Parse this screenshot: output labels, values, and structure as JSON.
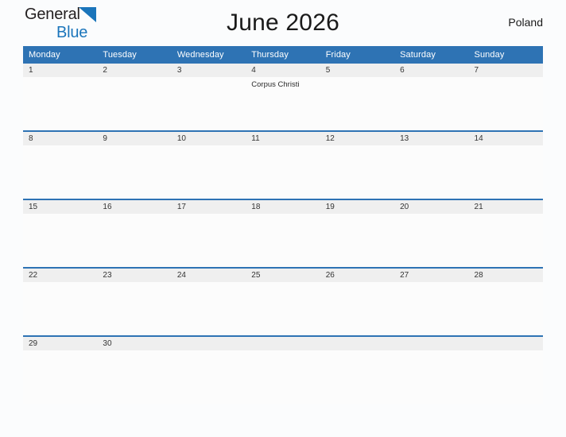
{
  "logo": {
    "line1": "General",
    "line2": "Blue",
    "triangle_icon": "triangle-icon",
    "accent_color": "#1b75bb"
  },
  "header": {
    "title": "June 2026",
    "region": "Poland"
  },
  "theme": {
    "header_blue": "#2e73b4",
    "daynum_band": "#efefef",
    "page_background": "#fbfcfd",
    "cell_background": "#fcfcfc"
  },
  "calendar": {
    "weekday_headers": [
      "Monday",
      "Tuesday",
      "Wednesday",
      "Thursday",
      "Friday",
      "Saturday",
      "Sunday"
    ],
    "weeks": [
      {
        "days": [
          {
            "number": "1",
            "events": []
          },
          {
            "number": "2",
            "events": []
          },
          {
            "number": "3",
            "events": []
          },
          {
            "number": "4",
            "events": [
              "Corpus Christi"
            ]
          },
          {
            "number": "5",
            "events": []
          },
          {
            "number": "6",
            "events": []
          },
          {
            "number": "7",
            "events": []
          }
        ]
      },
      {
        "days": [
          {
            "number": "8",
            "events": []
          },
          {
            "number": "9",
            "events": []
          },
          {
            "number": "10",
            "events": []
          },
          {
            "number": "11",
            "events": []
          },
          {
            "number": "12",
            "events": []
          },
          {
            "number": "13",
            "events": []
          },
          {
            "number": "14",
            "events": []
          }
        ]
      },
      {
        "days": [
          {
            "number": "15",
            "events": []
          },
          {
            "number": "16",
            "events": []
          },
          {
            "number": "17",
            "events": []
          },
          {
            "number": "18",
            "events": []
          },
          {
            "number": "19",
            "events": []
          },
          {
            "number": "20",
            "events": []
          },
          {
            "number": "21",
            "events": []
          }
        ]
      },
      {
        "days": [
          {
            "number": "22",
            "events": []
          },
          {
            "number": "23",
            "events": []
          },
          {
            "number": "24",
            "events": []
          },
          {
            "number": "25",
            "events": []
          },
          {
            "number": "26",
            "events": []
          },
          {
            "number": "27",
            "events": []
          },
          {
            "number": "28",
            "events": []
          }
        ]
      },
      {
        "days": [
          {
            "number": "29",
            "events": []
          },
          {
            "number": "30",
            "events": []
          },
          {
            "number": "",
            "events": []
          },
          {
            "number": "",
            "events": []
          },
          {
            "number": "",
            "events": []
          },
          {
            "number": "",
            "events": []
          },
          {
            "number": "",
            "events": []
          }
        ]
      }
    ]
  }
}
